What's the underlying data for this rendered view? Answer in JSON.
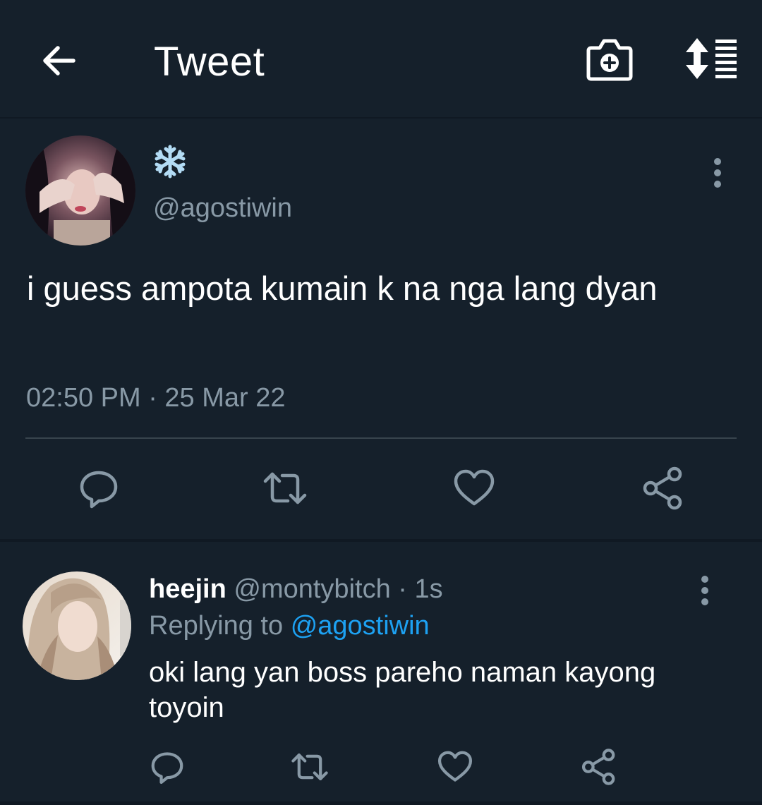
{
  "header": {
    "title": "Tweet",
    "back_icon": "arrow-left-icon",
    "camera_icon": "camera-add-icon",
    "sort_icon": "sort-list-icon"
  },
  "tweet": {
    "display_name_emoji": "snowflake-icon",
    "handle": "@agostiwin",
    "text": "i guess ampota kumain k na nga lang dyan",
    "timestamp": "02:50 PM · 25 Mar 22",
    "actions": [
      "reply-icon",
      "retweet-icon",
      "like-icon",
      "share-icon"
    ]
  },
  "reply": {
    "name": "heejin",
    "handle": "@montybitch",
    "time": "· 1s",
    "replying_prefix": "Replying to",
    "replying_to": "@agostiwin",
    "text": "oki lang yan boss pareho naman kayong toyoin"
  },
  "colors": {
    "background": "#15202b",
    "text_secondary": "#8899a6",
    "accent": "#1da1f2",
    "divider": "#38444d"
  }
}
